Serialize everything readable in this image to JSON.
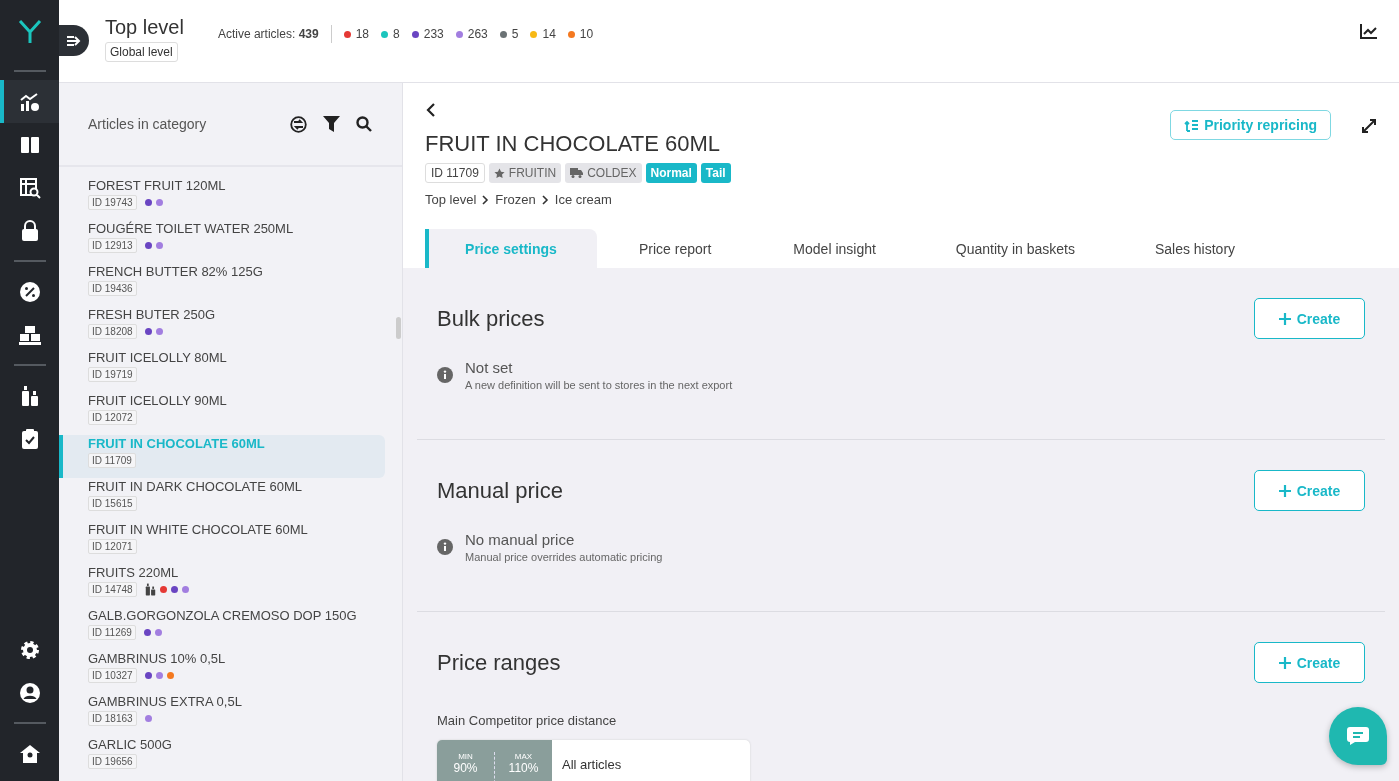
{
  "nav": {
    "items": [
      {
        "kind": "chart-gear",
        "selected": true
      },
      {
        "kind": "columns",
        "selected": false
      },
      {
        "kind": "table-search",
        "selected": false
      },
      {
        "kind": "lock",
        "selected": false
      },
      {
        "kind": "divider"
      },
      {
        "kind": "percent",
        "selected": false
      },
      {
        "kind": "boxes",
        "selected": false
      },
      {
        "kind": "divider"
      },
      {
        "kind": "bottles",
        "selected": false
      },
      {
        "kind": "clipboard",
        "selected": false
      }
    ],
    "bottom": [
      {
        "kind": "gear",
        "selected": false
      },
      {
        "kind": "user",
        "selected": false
      },
      {
        "kind": "divider"
      },
      {
        "kind": "home",
        "selected": false
      }
    ]
  },
  "header": {
    "title": "Top level",
    "badge": "Global level",
    "active_label": "Active articles:",
    "active_count": "439",
    "counts": [
      {
        "color": "#e53935",
        "value": "18"
      },
      {
        "color": "#1bc5bd",
        "value": "8"
      },
      {
        "color": "#6a45c2",
        "value": "233"
      },
      {
        "color": "#a27ee0",
        "value": "263"
      },
      {
        "color": "#6b7275",
        "value": "5"
      },
      {
        "color": "#f7b916",
        "value": "14"
      },
      {
        "color": "#f47920",
        "value": "10"
      }
    ]
  },
  "sidebar": {
    "title": "Articles in category",
    "items": [
      {
        "name": "FOREST FRUIT 120ML",
        "id": "ID 19743",
        "selected": false,
        "dots": [
          {
            "color": "#6a45c2"
          },
          {
            "color": "#a27ee0"
          }
        ]
      },
      {
        "name": "FOUGÉRE TOILET WATER 250ML",
        "id": "ID 12913",
        "selected": false,
        "dots": [
          {
            "color": "#6a45c2"
          },
          {
            "color": "#a27ee0"
          }
        ]
      },
      {
        "name": "FRENCH BUTTER 82% 125G",
        "id": "ID 19436",
        "selected": false
      },
      {
        "name": "FRESH BUTER 250G",
        "id": "ID 18208",
        "selected": false,
        "dots": [
          {
            "color": "#6a45c2"
          },
          {
            "color": "#a27ee0"
          }
        ]
      },
      {
        "name": "FRUIT ICELOLLY 80ML",
        "id": "ID 19719",
        "selected": false
      },
      {
        "name": "FRUIT ICELOLLY 90ML",
        "id": "ID 12072",
        "selected": false
      },
      {
        "name": "FRUIT IN CHOCOLATE 60ML",
        "id": "ID 11709",
        "selected": true
      },
      {
        "name": "FRUIT IN DARK CHOCOLATE 60ML",
        "id": "ID 15615",
        "selected": false
      },
      {
        "name": "FRUIT IN WHITE CHOCOLATE 60ML",
        "id": "ID 12071",
        "selected": false
      },
      {
        "name": "FRUITS 220ML",
        "id": "ID 14748",
        "selected": false,
        "bottles": true,
        "dots": [
          {
            "color": "#e53935"
          },
          {
            "color": "#6a45c2"
          },
          {
            "color": "#a27ee0"
          }
        ]
      },
      {
        "name": "GALB.GORGONZOLA CREMOSO DOP 150G",
        "id": "ID 11269",
        "selected": false,
        "dots": [
          {
            "color": "#6a45c2"
          },
          {
            "color": "#a27ee0"
          }
        ]
      },
      {
        "name": "GAMBRINUS 10% 0,5L",
        "id": "ID 10327",
        "selected": false,
        "dots": [
          {
            "color": "#6a45c2"
          },
          {
            "color": "#a27ee0"
          },
          {
            "color": "#f47920"
          }
        ]
      },
      {
        "name": "GAMBRINUS EXTRA 0,5L",
        "id": "ID 18163",
        "selected": false,
        "dots": [
          {
            "color": "#a27ee0"
          }
        ]
      },
      {
        "name": "GARLIC 500G",
        "id": "ID 19656",
        "selected": false
      }
    ]
  },
  "detail": {
    "title": "FRUIT IN CHOCOLATE 60ML",
    "tags": [
      {
        "kind": "id",
        "label": "ID 11709"
      },
      {
        "kind": "brand",
        "label": "FRUITIN"
      },
      {
        "kind": "supplier",
        "label": "COLDEX"
      },
      {
        "kind": "status",
        "label": "Normal"
      },
      {
        "kind": "status",
        "label": "Tail"
      }
    ],
    "breadcrumb": [
      "Top level",
      "Frozen",
      "Ice cream"
    ],
    "action": "Priority repricing",
    "tabs": [
      {
        "label": "Price settings",
        "selected": true
      },
      {
        "label": "Price report",
        "selected": false
      },
      {
        "label": "Model insight",
        "selected": false
      },
      {
        "label": "Quantity in baskets",
        "selected": false
      },
      {
        "label": "Sales history",
        "selected": false
      }
    ],
    "sections": [
      {
        "kind": "info",
        "title": "Bulk prices",
        "button": "Create",
        "info_title": "Not set",
        "info_text": "A new definition will be sent to stores in the next export"
      },
      {
        "kind": "info",
        "title": "Manual price",
        "button": "Create",
        "info_title": "No manual price",
        "info_text": "Manual price overrides automatic pricing"
      },
      {
        "kind": "ranges",
        "title": "Price ranges",
        "button": "Create",
        "subtitle": "Main Competitor price distance",
        "range": {
          "min_label": "MIN",
          "min_value": "90%",
          "max_label": "MAX",
          "max_value": "110%",
          "scope": "All articles"
        }
      }
    ]
  }
}
